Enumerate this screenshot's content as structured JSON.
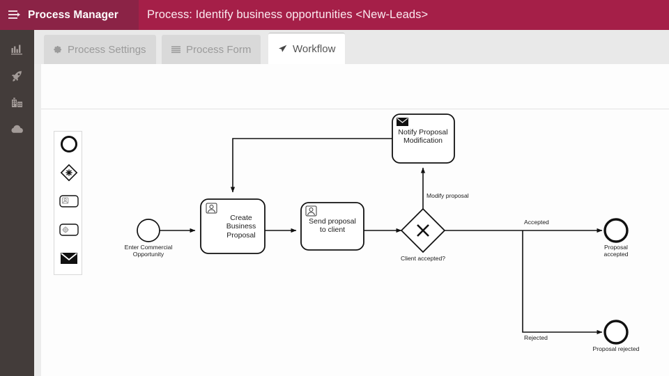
{
  "header": {
    "menu_icon": "hamburger-icon",
    "brand": "Process Manager",
    "title": "Process: Identify business opportunities <New-Leads>",
    "brand_bg": "#8b2346",
    "bar_bg": "#a51f48"
  },
  "sidebar": {
    "bg": "#433c3a",
    "items": [
      {
        "icon": "bar-chart-icon",
        "name": "sidebar-item-dashboard"
      },
      {
        "icon": "rocket-icon",
        "name": "sidebar-item-launch"
      },
      {
        "icon": "building-icon",
        "name": "sidebar-item-organization"
      },
      {
        "icon": "cloud-icon",
        "name": "sidebar-item-cloud"
      }
    ]
  },
  "tabs": [
    {
      "label": "Process Settings",
      "icon": "gear-icon",
      "active": false
    },
    {
      "label": "Process Form",
      "icon": "list-icon",
      "active": false
    },
    {
      "label": "Workflow",
      "icon": "cursor-arrow-icon",
      "active": true
    }
  ],
  "palette": {
    "items": [
      {
        "name": "palette-start-event",
        "icon": "circle-icon",
        "title": "Start Event"
      },
      {
        "name": "palette-gateway",
        "icon": "diamond-icon",
        "title": "Gateway"
      },
      {
        "name": "palette-user-task",
        "icon": "user-task-icon",
        "title": "User Task"
      },
      {
        "name": "palette-service-task",
        "icon": "service-task-icon",
        "title": "Service Task"
      },
      {
        "name": "palette-message-task",
        "icon": "envelope-icon",
        "title": "Message Task"
      }
    ]
  },
  "workflow": {
    "nodes": {
      "start": {
        "label": "Enter Commercial\nOpportunity",
        "label_line1": "Enter Commercial",
        "label_line2": "Opportunity",
        "type": "start-event"
      },
      "create_proposal": {
        "label_line1": "Create",
        "label_line2": "Business",
        "label_line3": "Proposal",
        "type": "user-task"
      },
      "send_proposal": {
        "label_line1": "Send proposal",
        "label_line2": "to client",
        "type": "user-task"
      },
      "notify": {
        "label_line1": "Notify Proposal",
        "label_line2": "Modification",
        "type": "message-task"
      },
      "gateway": {
        "label": "Client accepted?",
        "type": "exclusive-gateway",
        "symbol": "X"
      },
      "end_accepted": {
        "label_line1": "Proposal",
        "label_line2": "accepted",
        "type": "end-event"
      },
      "end_rejected": {
        "label": "Proposal rejected",
        "type": "end-event"
      }
    },
    "edge_labels": {
      "modify": "Modify proposal",
      "accepted": "Accepted",
      "rejected": "Rejected"
    }
  }
}
